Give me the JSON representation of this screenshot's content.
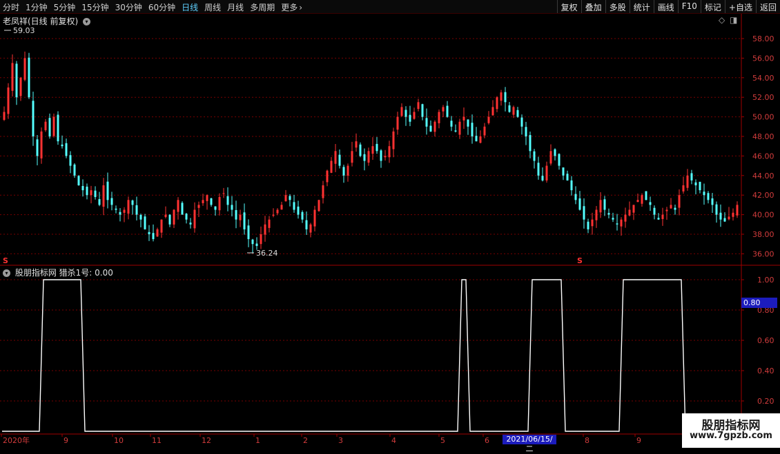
{
  "toolbar": {
    "periods": [
      "分时",
      "1分钟",
      "5分钟",
      "15分钟",
      "30分钟",
      "60分钟",
      "日线",
      "周线",
      "月线",
      "多周期"
    ],
    "active_period": "日线",
    "more_label": "更多",
    "right_buttons": [
      "复权",
      "叠加",
      "多股",
      "统计",
      "画线",
      "F10",
      "标记",
      "+自选",
      "返回"
    ]
  },
  "main_pane": {
    "title": "老凤祥(日线 前复权)",
    "high_label": "59.03",
    "low_label": "36.24",
    "y_ticks": [
      "58.00",
      "56.00",
      "54.00",
      "52.00",
      "50.00",
      "48.00",
      "46.00",
      "44.00",
      "42.00",
      "40.00",
      "38.00",
      "36.00"
    ],
    "marker_glyph": "S"
  },
  "indicator_pane": {
    "title": "股朋指标网 猎杀1号: 0.00",
    "y_ticks": [
      "1.00",
      "0.80",
      "0.60",
      "0.40",
      "0.20"
    ],
    "current_value_box": "0.80"
  },
  "x_axis": {
    "labels": [
      "2020年",
      "9",
      "10",
      "11",
      "12",
      "1",
      "2",
      "3",
      "4",
      "5",
      "6",
      "2021/06/15/二",
      "8",
      "9"
    ],
    "highlight": "2021/06/15/二"
  },
  "watermark": {
    "line1": "股朋指标网",
    "line2": "www.7gpzb.com"
  },
  "colors": {
    "up": "#ff3232",
    "down": "#54ffff",
    "grid": "#7a0000",
    "axis": "#a00000",
    "signal": "#ffffff",
    "accent": "#5fd0ff"
  },
  "chart_data": [
    {
      "type": "candlestick",
      "title": "老凤祥(日线 前复权)",
      "ylim": [
        36,
        59
      ],
      "annotations": [
        {
          "label": "59.03",
          "kind": "high"
        },
        {
          "label": "36.24",
          "kind": "low"
        }
      ],
      "closes": [
        50.5,
        53.0,
        55.5,
        52.0,
        54.0,
        56.0,
        52.0,
        48.0,
        46.0,
        48.5,
        49.5,
        48.0,
        50.0,
        47.5,
        47.0,
        46.0,
        45.0,
        44.0,
        43.0,
        42.5,
        42.0,
        42.5,
        41.8,
        41.0,
        43.0,
        41.5,
        41.0,
        40.5,
        40.0,
        40.5,
        41.5,
        41.0,
        40.0,
        39.5,
        38.5,
        38.0,
        37.5,
        38.5,
        39.5,
        40.0,
        39.0,
        40.5,
        41.5,
        40.0,
        39.5,
        39.0,
        40.5,
        41.0,
        41.5,
        42.0,
        41.0,
        40.5,
        41.8,
        42.2,
        41.0,
        40.5,
        39.5,
        40.0,
        38.5,
        37.5,
        37.0,
        36.8,
        38.0,
        39.0,
        39.5,
        40.0,
        40.5,
        41.0,
        42.0,
        41.5,
        40.5,
        40.0,
        39.5,
        38.5,
        39.0,
        40.5,
        41.5,
        43.0,
        44.5,
        45.5,
        46.5,
        45.0,
        44.0,
        45.0,
        46.5,
        47.5,
        46.0,
        45.5,
        46.5,
        47.0,
        46.5,
        45.5,
        46.0,
        47.0,
        48.5,
        50.0,
        51.0,
        50.0,
        49.5,
        50.5,
        51.5,
        50.0,
        49.0,
        48.5,
        49.5,
        50.5,
        51.0,
        50.0,
        49.0,
        48.5,
        49.5,
        50.0,
        49.0,
        48.0,
        47.5,
        48.0,
        49.0,
        50.0,
        51.0,
        52.0,
        52.5,
        51.5,
        50.5,
        51.0,
        50.0,
        49.0,
        48.0,
        46.5,
        45.5,
        44.0,
        43.5,
        45.0,
        46.5,
        46.0,
        45.0,
        44.0,
        43.5,
        42.5,
        41.5,
        40.5,
        39.5,
        38.5,
        39.5,
        40.5,
        41.5,
        40.5,
        40.0,
        39.5,
        39.0,
        39.5,
        40.0,
        40.5,
        41.0,
        41.5,
        42.0,
        41.5,
        41.0,
        40.0,
        39.5,
        40.0,
        40.5,
        41.0,
        40.5,
        42.0,
        43.0,
        44.0,
        43.5,
        43.0,
        42.5,
        42.0,
        41.5,
        41.0,
        40.0,
        39.5,
        39.3,
        39.8,
        40.2,
        41.0
      ]
    },
    {
      "type": "line",
      "title": "猎杀1号",
      "ylim": [
        0,
        1.05
      ],
      "x": [
        0,
        9,
        10,
        19,
        20,
        110,
        111,
        112,
        113,
        127,
        128,
        135,
        136,
        149,
        150,
        164,
        165,
        186
      ],
      "values": [
        0,
        0,
        1,
        1,
        0,
        0,
        1,
        1,
        0,
        0,
        1,
        1,
        0,
        0,
        1,
        1,
        0,
        0
      ]
    }
  ]
}
